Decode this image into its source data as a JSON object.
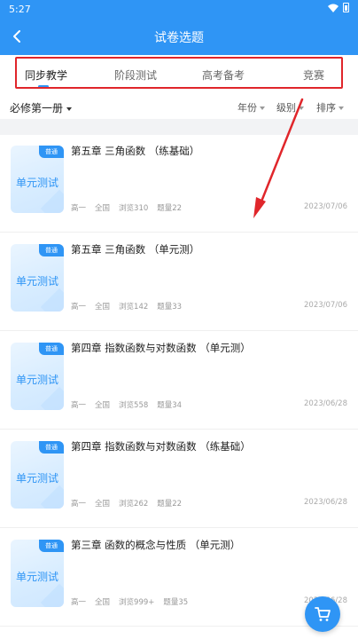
{
  "status": {
    "time": "5:27"
  },
  "header": {
    "title": "试卷选题"
  },
  "tabs": [
    {
      "label": "同步教学"
    },
    {
      "label": "阶段测试"
    },
    {
      "label": "高考备考"
    },
    {
      "label": "竞赛"
    }
  ],
  "filters": {
    "book": "必修第一册",
    "year": "年份",
    "level": "级别",
    "sort": "排序"
  },
  "papers": [
    {
      "badge": "普通",
      "thumb_label": "单元测试",
      "title": "第五章 三角函数 （练基础）",
      "grade": "高一",
      "region": "全国",
      "views": "浏览310",
      "questions": "题量22",
      "date": "2023/07/06"
    },
    {
      "badge": "普通",
      "thumb_label": "单元测试",
      "title": "第五章 三角函数 （单元测）",
      "grade": "高一",
      "region": "全国",
      "views": "浏览142",
      "questions": "题量33",
      "date": "2023/07/06"
    },
    {
      "badge": "普通",
      "thumb_label": "单元测试",
      "title": "第四章 指数函数与对数函数 （单元测）",
      "grade": "高一",
      "region": "全国",
      "views": "浏览558",
      "questions": "题量34",
      "date": "2023/06/28"
    },
    {
      "badge": "普通",
      "thumb_label": "单元测试",
      "title": "第四章 指数函数与对数函数 （练基础）",
      "grade": "高一",
      "region": "全国",
      "views": "浏览262",
      "questions": "题量22",
      "date": "2023/06/28"
    },
    {
      "badge": "普通",
      "thumb_label": "单元测试",
      "title": "第三章 函数的概念与性质 （单元测）",
      "grade": "高一",
      "region": "全国",
      "views": "浏览999+",
      "questions": "题量35",
      "date": "2023/06/28"
    }
  ],
  "colors": {
    "primary": "#2f95f5",
    "annotation": "#e0262b"
  },
  "icons": {
    "back": "chevron-left-icon",
    "cart": "cart-icon"
  }
}
